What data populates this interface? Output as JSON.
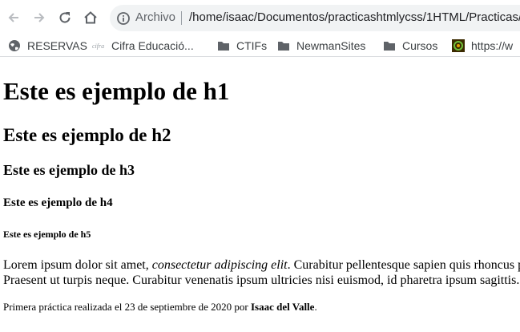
{
  "browser": {
    "scheme_label": "Archivo",
    "url": "/home/isaac/Documentos/practicashtmlycss/1HTML/Practicas/"
  },
  "bookmarks": [
    {
      "label": "RESERVAS",
      "icon": "globe-icon"
    },
    {
      "label": "Cifra Educació...",
      "icon": "cifra-favicon-icon"
    },
    {
      "label": "CTIFs",
      "icon": "folder-icon"
    },
    {
      "label": "NewmanSites",
      "icon": "folder-icon"
    },
    {
      "label": "Cursos",
      "icon": "folder-icon"
    },
    {
      "label": "https://w",
      "icon": "site-favicon-icon"
    }
  ],
  "page": {
    "h1": "Este es ejemplo de h1",
    "h2": "Este es ejemplo de h2",
    "h3": "Este es ejemplo de h3",
    "h4": "Este es ejemplo de h4",
    "h5": "Este es ejemplo de h5",
    "lorem_start": "Lorem ipsum dolor sit amet, ",
    "lorem_italic": "consectetur adipiscing elit",
    "lorem_rest": ". Curabitur pellentesque sapien quis rhoncus p",
    "lorem_line2": "Praesent ut turpis neque. Curabitur venenatis ipsum ultricies nisi euismod, id pharetra ipsum sagittis.",
    "footer_text": "Primera práctica realizada el 23 de septiembre de 2020 por ",
    "footer_author": "Isaac del Valle",
    "footer_end": "."
  }
}
